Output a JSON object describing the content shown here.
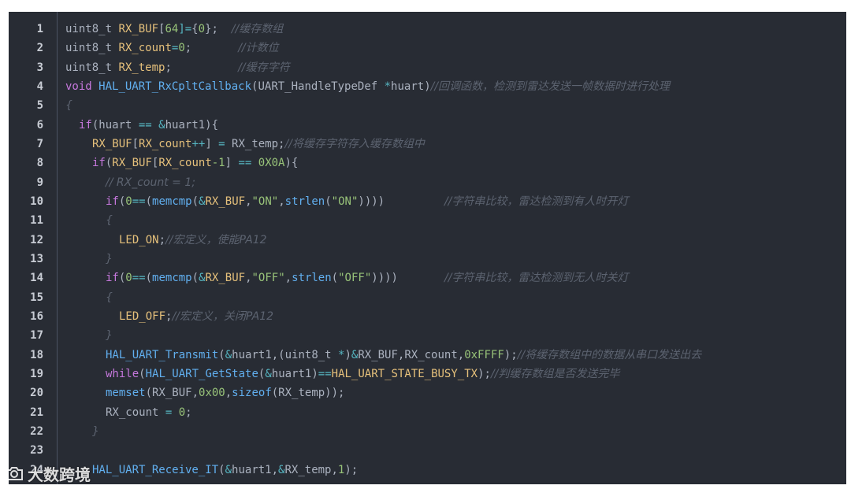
{
  "colors": {
    "background": "#282c34",
    "default_text": "#abb2bf",
    "keyword": "#c678dd",
    "type": "#c678dd",
    "function": "#61afef",
    "variable": "#e5c07b",
    "number": "#98c379",
    "string": "#98c379",
    "operator": "#56b6c2",
    "comment": "#5c6370",
    "line_number": "#c8ccd4"
  },
  "watermark": {
    "icon": "camera-icon",
    "text": "大数跨境"
  },
  "lines": [
    {
      "n": "1",
      "indent": 0,
      "tokens": [
        {
          "t": "uint8_t ",
          "c": "default_text"
        },
        {
          "t": "RX_BUF",
          "c": "variable"
        },
        {
          "t": "[",
          "c": "default_text"
        },
        {
          "t": "64",
          "c": "number"
        },
        {
          "t": "]=",
          "c": "operator"
        },
        {
          "t": "{",
          "c": "default_text"
        },
        {
          "t": "0",
          "c": "number"
        },
        {
          "t": "};  ",
          "c": "default_text"
        },
        {
          "t": "//缓存数组",
          "c": "comment"
        }
      ]
    },
    {
      "n": "2",
      "indent": 0,
      "tokens": [
        {
          "t": "uint8_t ",
          "c": "default_text"
        },
        {
          "t": "RX_count",
          "c": "variable"
        },
        {
          "t": "=",
          "c": "operator"
        },
        {
          "t": "0",
          "c": "number"
        },
        {
          "t": ";       ",
          "c": "default_text"
        },
        {
          "t": "//计数位",
          "c": "comment"
        }
      ]
    },
    {
      "n": "3",
      "indent": 0,
      "tokens": [
        {
          "t": "uint8_t ",
          "c": "default_text"
        },
        {
          "t": "RX_temp",
          "c": "variable"
        },
        {
          "t": ";          ",
          "c": "default_text"
        },
        {
          "t": "//缓存字符",
          "c": "comment"
        }
      ]
    },
    {
      "n": "4",
      "indent": 0,
      "tokens": [
        {
          "t": "void ",
          "c": "keyword"
        },
        {
          "t": "HAL_UART_RxCpltCallback",
          "c": "function"
        },
        {
          "t": "(UART_HandleTypeDef ",
          "c": "default_text"
        },
        {
          "t": "*",
          "c": "operator"
        },
        {
          "t": "huart)",
          "c": "default_text"
        },
        {
          "t": "//回调函数，检测到雷达发送一帧数据时进行处理",
          "c": "comment"
        }
      ]
    },
    {
      "n": "5",
      "indent": 0,
      "tokens": [
        {
          "t": "{",
          "c": "comment"
        }
      ]
    },
    {
      "n": "6",
      "indent": 1,
      "tokens": [
        {
          "t": "if",
          "c": "keyword"
        },
        {
          "t": "(huart ",
          "c": "default_text"
        },
        {
          "t": "==",
          "c": "operator"
        },
        {
          "t": " ",
          "c": "default_text"
        },
        {
          "t": "&",
          "c": "operator"
        },
        {
          "t": "huart1){",
          "c": "default_text"
        }
      ]
    },
    {
      "n": "7",
      "indent": 2,
      "tokens": [
        {
          "t": "RX_BUF",
          "c": "variable"
        },
        {
          "t": "[",
          "c": "default_text"
        },
        {
          "t": "RX_count",
          "c": "variable"
        },
        {
          "t": "++",
          "c": "operator"
        },
        {
          "t": "] ",
          "c": "default_text"
        },
        {
          "t": "=",
          "c": "operator"
        },
        {
          "t": " RX_temp;",
          "c": "default_text"
        },
        {
          "t": "//将缓存字符存入缓存数组中",
          "c": "comment"
        }
      ]
    },
    {
      "n": "8",
      "indent": 2,
      "tokens": [
        {
          "t": "if",
          "c": "keyword"
        },
        {
          "t": "(",
          "c": "default_text"
        },
        {
          "t": "RX_BUF",
          "c": "variable"
        },
        {
          "t": "[",
          "c": "default_text"
        },
        {
          "t": "RX_count",
          "c": "variable"
        },
        {
          "t": "-1",
          "c": "number"
        },
        {
          "t": "] ",
          "c": "default_text"
        },
        {
          "t": "==",
          "c": "operator"
        },
        {
          "t": " ",
          "c": "default_text"
        },
        {
          "t": "0X0A",
          "c": "number"
        },
        {
          "t": "){",
          "c": "default_text"
        }
      ]
    },
    {
      "n": "9",
      "indent": 3,
      "tokens": [
        {
          "t": "// RX_count = 1;",
          "c": "comment"
        }
      ]
    },
    {
      "n": "10",
      "indent": 3,
      "tokens": [
        {
          "t": "if",
          "c": "keyword"
        },
        {
          "t": "(",
          "c": "default_text"
        },
        {
          "t": "0",
          "c": "number"
        },
        {
          "t": "==",
          "c": "operator"
        },
        {
          "t": "(",
          "c": "default_text"
        },
        {
          "t": "memcmp",
          "c": "function"
        },
        {
          "t": "(",
          "c": "default_text"
        },
        {
          "t": "&",
          "c": "operator"
        },
        {
          "t": "RX_BUF",
          "c": "variable"
        },
        {
          "t": ",",
          "c": "default_text"
        },
        {
          "t": "\"ON\"",
          "c": "string"
        },
        {
          "t": ",",
          "c": "default_text"
        },
        {
          "t": "strlen",
          "c": "function"
        },
        {
          "t": "(",
          "c": "default_text"
        },
        {
          "t": "\"ON\"",
          "c": "string"
        },
        {
          "t": "))))         ",
          "c": "default_text"
        },
        {
          "t": "//字符串比较，雷达检测到有人时开灯",
          "c": "comment"
        }
      ]
    },
    {
      "n": "11",
      "indent": 3,
      "tokens": [
        {
          "t": "{",
          "c": "comment"
        }
      ]
    },
    {
      "n": "12",
      "indent": 4,
      "tokens": [
        {
          "t": "LED_ON",
          "c": "variable"
        },
        {
          "t": ";",
          "c": "default_text"
        },
        {
          "t": "//宏定义，使能PA12",
          "c": "comment"
        }
      ]
    },
    {
      "n": "13",
      "indent": 3,
      "tokens": [
        {
          "t": "}",
          "c": "comment"
        }
      ]
    },
    {
      "n": "14",
      "indent": 3,
      "tokens": [
        {
          "t": "if",
          "c": "keyword"
        },
        {
          "t": "(",
          "c": "default_text"
        },
        {
          "t": "0",
          "c": "number"
        },
        {
          "t": "==",
          "c": "operator"
        },
        {
          "t": "(",
          "c": "default_text"
        },
        {
          "t": "memcmp",
          "c": "function"
        },
        {
          "t": "(",
          "c": "default_text"
        },
        {
          "t": "&",
          "c": "operator"
        },
        {
          "t": "RX_BUF",
          "c": "variable"
        },
        {
          "t": ",",
          "c": "default_text"
        },
        {
          "t": "\"OFF\"",
          "c": "string"
        },
        {
          "t": ",",
          "c": "default_text"
        },
        {
          "t": "strlen",
          "c": "function"
        },
        {
          "t": "(",
          "c": "default_text"
        },
        {
          "t": "\"OFF\"",
          "c": "string"
        },
        {
          "t": "))))       ",
          "c": "default_text"
        },
        {
          "t": "//字符串比较，雷达检测到无人时关灯",
          "c": "comment"
        }
      ]
    },
    {
      "n": "15",
      "indent": 3,
      "tokens": [
        {
          "t": "{",
          "c": "comment"
        }
      ]
    },
    {
      "n": "16",
      "indent": 4,
      "tokens": [
        {
          "t": "LED_OFF",
          "c": "variable"
        },
        {
          "t": ";",
          "c": "default_text"
        },
        {
          "t": "//宏定义，关闭PA12",
          "c": "comment"
        }
      ]
    },
    {
      "n": "17",
      "indent": 3,
      "tokens": [
        {
          "t": "}",
          "c": "comment"
        }
      ]
    },
    {
      "n": "18",
      "indent": 3,
      "tokens": [
        {
          "t": "HAL_UART_Transmit",
          "c": "function"
        },
        {
          "t": "(",
          "c": "default_text"
        },
        {
          "t": "&",
          "c": "operator"
        },
        {
          "t": "huart1,(uint8_t ",
          "c": "default_text"
        },
        {
          "t": "*",
          "c": "operator"
        },
        {
          "t": ")",
          "c": "default_text"
        },
        {
          "t": "&",
          "c": "operator"
        },
        {
          "t": "RX_BUF,RX_count,",
          "c": "default_text"
        },
        {
          "t": "0xFFFF",
          "c": "number"
        },
        {
          "t": ");",
          "c": "default_text"
        },
        {
          "t": "//将缓存数组中的数据从串口发送出去",
          "c": "comment"
        }
      ]
    },
    {
      "n": "19",
      "indent": 3,
      "tokens": [
        {
          "t": "while",
          "c": "keyword"
        },
        {
          "t": "(",
          "c": "default_text"
        },
        {
          "t": "HAL_UART_GetState",
          "c": "function"
        },
        {
          "t": "(",
          "c": "default_text"
        },
        {
          "t": "&",
          "c": "operator"
        },
        {
          "t": "huart1)",
          "c": "default_text"
        },
        {
          "t": "==",
          "c": "operator"
        },
        {
          "t": "HAL_UART_STATE_BUSY_TX",
          "c": "variable"
        },
        {
          "t": ");",
          "c": "default_text"
        },
        {
          "t": "//判缓存数组是否发送完毕",
          "c": "comment"
        }
      ]
    },
    {
      "n": "20",
      "indent": 3,
      "tokens": [
        {
          "t": "memset",
          "c": "function"
        },
        {
          "t": "(RX_BUF,",
          "c": "default_text"
        },
        {
          "t": "0x00",
          "c": "number"
        },
        {
          "t": ",",
          "c": "default_text"
        },
        {
          "t": "sizeof",
          "c": "function"
        },
        {
          "t": "(RX_temp));",
          "c": "default_text"
        }
      ]
    },
    {
      "n": "21",
      "indent": 3,
      "tokens": [
        {
          "t": "RX_count ",
          "c": "default_text"
        },
        {
          "t": "=",
          "c": "operator"
        },
        {
          "t": " ",
          "c": "default_text"
        },
        {
          "t": "0",
          "c": "number"
        },
        {
          "t": ";",
          "c": "default_text"
        }
      ]
    },
    {
      "n": "22",
      "indent": 2,
      "tokens": [
        {
          "t": "}",
          "c": "comment"
        }
      ]
    },
    {
      "n": "23",
      "indent": 0,
      "tokens": []
    },
    {
      "n": "24",
      "indent": 2,
      "tokens": [
        {
          "t": "HAL_UART_Receive_IT",
          "c": "function"
        },
        {
          "t": "(",
          "c": "default_text"
        },
        {
          "t": "&",
          "c": "operator"
        },
        {
          "t": "huart1,",
          "c": "default_text"
        },
        {
          "t": "&",
          "c": "operator"
        },
        {
          "t": "RX_temp,",
          "c": "default_text"
        },
        {
          "t": "1",
          "c": "number"
        },
        {
          "t": ");",
          "c": "default_text"
        }
      ]
    }
  ]
}
